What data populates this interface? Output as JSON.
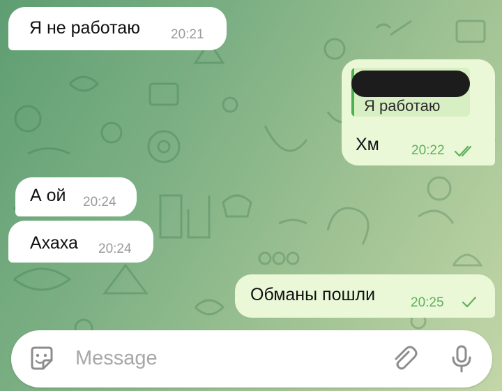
{
  "messages": [
    {
      "direction": "incoming",
      "text": "Я не работаю",
      "time": "20:21"
    },
    {
      "direction": "outgoing",
      "reply_quote": "Я работаю",
      "text": "Хм",
      "time": "20:22",
      "status": "read"
    },
    {
      "direction": "incoming",
      "text": "А ой",
      "time": "20:24"
    },
    {
      "direction": "incoming",
      "text": "Ахаха",
      "time": "20:24"
    },
    {
      "direction": "outgoing",
      "text": "Обманы пошли",
      "time": "20:25",
      "status": "sent"
    }
  ],
  "input": {
    "placeholder": "Message",
    "left_icon": "sticker-emoji-icon",
    "right_icons": [
      "attach-paperclip-icon",
      "microphone-icon"
    ]
  },
  "colors": {
    "incoming_bubble": "#ffffff",
    "outgoing_bubble": "#eaf8d8",
    "outgoing_time": "#5fb05a",
    "incoming_time": "#9a9a9a",
    "reply_bar": "#4caf50",
    "icon_gray": "#8d8d8d"
  }
}
